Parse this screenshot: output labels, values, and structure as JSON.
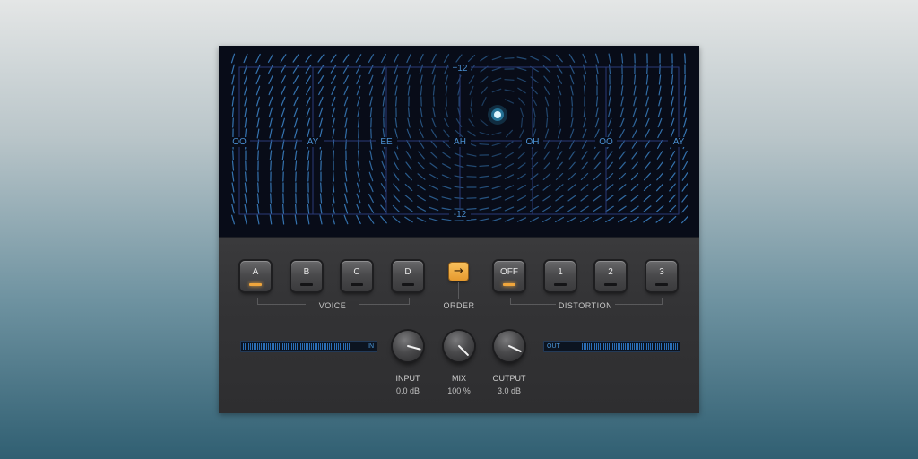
{
  "display": {
    "top_label": "+12",
    "bottom_label": "-12",
    "vowels": [
      "OO",
      "AY",
      "EE",
      "AH",
      "OH",
      "OO",
      "AY"
    ],
    "grid_color": "#2a3a78",
    "dash_color": "#3a7fc0",
    "label_color": "#4a8fd0",
    "dot_color": "#3ec8ff"
  },
  "voice": {
    "label": "VOICE",
    "buttons": [
      {
        "label": "A",
        "active": true
      },
      {
        "label": "B",
        "active": false
      },
      {
        "label": "C",
        "active": false
      },
      {
        "label": "D",
        "active": false
      }
    ]
  },
  "order": {
    "label": "ORDER",
    "icon": "arrow-right-icon",
    "glyph": "→"
  },
  "distortion": {
    "label": "DISTORTION",
    "buttons": [
      {
        "label": "OFF",
        "active": true
      },
      {
        "label": "1",
        "active": false
      },
      {
        "label": "2",
        "active": false
      },
      {
        "label": "3",
        "active": false
      }
    ]
  },
  "meters": {
    "in": {
      "tag": "IN",
      "level": 0.9
    },
    "out": {
      "tag": "OUT",
      "level": 0.85
    }
  },
  "knobs": {
    "input": {
      "label": "INPUT",
      "value": "0.0 dB"
    },
    "mix": {
      "label": "MIX",
      "value": "100 %"
    },
    "output": {
      "label": "OUTPUT",
      "value": "3.0 dB"
    }
  },
  "accent": "#f0a63c"
}
